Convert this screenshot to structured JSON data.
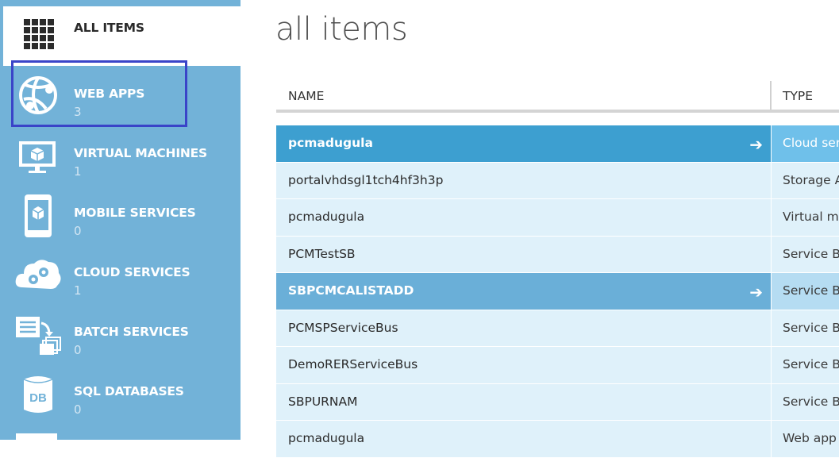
{
  "sidebar": {
    "items": [
      {
        "label": "ALL ITEMS",
        "count": "",
        "icon": "grid-icon"
      },
      {
        "label": "WEB APPS",
        "count": "3",
        "icon": "web-apps-globe-icon"
      },
      {
        "label": "VIRTUAL MACHINES",
        "count": "1",
        "icon": "monitor-cube-icon"
      },
      {
        "label": "MOBILE SERVICES",
        "count": "0",
        "icon": "phone-cube-icon"
      },
      {
        "label": "CLOUD SERVICES",
        "count": "1",
        "icon": "cloud-gears-icon"
      },
      {
        "label": "BATCH SERVICES",
        "count": "0",
        "icon": "batch-documents-icon"
      },
      {
        "label": "SQL DATABASES",
        "count": "0",
        "icon": "database-db-icon"
      }
    ]
  },
  "main": {
    "title": "all items",
    "columns": {
      "name": "NAME",
      "type": "TYPE"
    },
    "rows": [
      {
        "name": "pcmadugula",
        "type": "Cloud serv"
      },
      {
        "name": "portalvhdsgl1tch4hf3h3p",
        "type": "Storage A"
      },
      {
        "name": "pcmadugula",
        "type": "Virtual ma"
      },
      {
        "name": "PCMTestSB",
        "type": "Service Bu"
      },
      {
        "name": "SBPCMCALISTADD",
        "type": "Service Bu"
      },
      {
        "name": "PCMSPServiceBus",
        "type": "Service Bu"
      },
      {
        "name": "DemoRERServiceBus",
        "type": "Service Bu"
      },
      {
        "name": "SBPURNAM",
        "type": "Service Bu"
      },
      {
        "name": "pcmadugula",
        "type": "Web app"
      }
    ],
    "row_arrow": "➔"
  },
  "colors": {
    "sidebar_bg": "#72b2d8",
    "selection_outline": "#3a44c8",
    "row_selected_strong": "#3d9fd0",
    "row_selected_soft": "#6aafd8",
    "row_bg": "#dff1fa"
  }
}
